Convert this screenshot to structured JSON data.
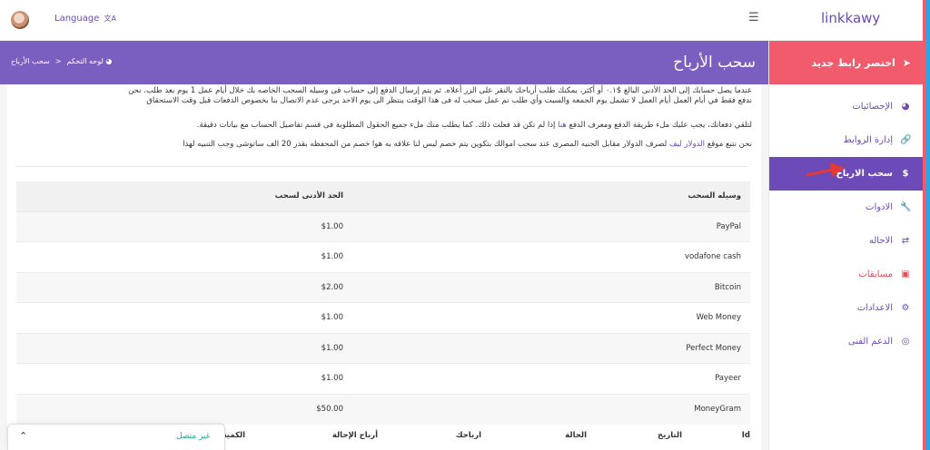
{
  "topbar": {
    "language_label": "Language",
    "language_icon": "translate-icon"
  },
  "brand": {
    "name": "linkkawy"
  },
  "sidebar": {
    "shorten_label": "اختصر رابط جديد",
    "items": [
      {
        "label": "الإحصائيات",
        "icon": "dashboard-icon"
      },
      {
        "label": "إدارة الروابط",
        "icon": "link-icon"
      },
      {
        "label": "سحب الارباح",
        "icon": "dollar-icon"
      },
      {
        "label": "الادوات",
        "icon": "wrench-icon"
      },
      {
        "label": "الاحاله",
        "icon": "exchange-icon"
      },
      {
        "label": "مسابقات",
        "icon": "credit-card-icon"
      },
      {
        "label": "الاعدادات",
        "icon": "gears-icon"
      },
      {
        "label": "الدعم الفنى",
        "icon": "lifebuoy-icon"
      }
    ]
  },
  "header": {
    "title": "سحب الأرباح",
    "crumb_home": "لوحه التحكم",
    "crumb_sep": ">",
    "crumb_current": "سحب الأرباح"
  },
  "content": {
    "para1_line1": "عندما يصل حسابك إلى الحد الأدنى البالغ $٠.١ أو أكثر، يمكنك طلب أرباحك بالنقر على الزر أعلاه. ثم يتم إرسال الدفع إلى حساب فى وسيله السحب الخاصه بك خلال أيام عمل 1 يوم بعد طلب. نحن",
    "para1_line2": "ندفع فقط في أيام العمل أيام العمل لا تشمل يوم الجمعه والسبت وأي طلب تم عمل سحب له فى هذا الوقت ينتظر الى يوم الاحد يرجى عدم الاتصال بنا بخصوص الدفعات قبل وقت الاستحقاق",
    "para2_before": "لتلقي دفعاتك، يجب عليك ملء طريقة الدفع ومعرف الدفع ",
    "para2_link": "هنا",
    "para2_after": " إذا لم تكن قد فعلت ذلك. كما يطلب منك ملء جميع الحقول المطلوبة فى قسم تفاصيل الحساب مع بيانات دقيقة.",
    "para3_before": "نحن نتبع موقع ",
    "para3_link": "الدولار ليف",
    "para3_after": " لصرف الدولار مقابل الجنيه المصرى عند سحب اموالك بتكوين يتم خصم ليس لنا علاقه به هوا خصم من المحفظه بقدر 20 الف ساتوشى وجب التنبيه لهذا"
  },
  "rates_table": {
    "headers": [
      "وسيله السحب",
      "الحد الأدنى لسحب"
    ],
    "rows": [
      [
        "PayPal",
        "$1.00"
      ],
      [
        "vodafone cash",
        "$1.00"
      ],
      [
        "Bitcoin",
        "$2.00"
      ],
      [
        "Web Money",
        "$1.00"
      ],
      [
        "Perfect Money",
        "$1.00"
      ],
      [
        "Payeer",
        "$1.00"
      ],
      [
        "MoneyGram",
        "$50.00"
      ]
    ]
  },
  "history_table": {
    "headers": [
      "Id",
      "التاريخ",
      "الحالة",
      "ارباحك",
      "أرباح الإحالة",
      "الكمية"
    ]
  },
  "chat": {
    "status": "غير متصل"
  }
}
